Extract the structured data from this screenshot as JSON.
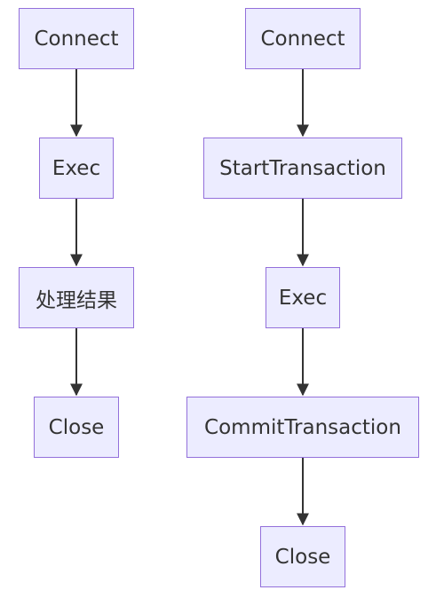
{
  "colors": {
    "node_fill": "#ECECFF",
    "node_border": "#9370DB",
    "edge": "#333333",
    "text": "#333333"
  },
  "flow_left": {
    "nodes": [
      "Connect",
      "Exec",
      "处理结果",
      "Close"
    ]
  },
  "flow_right": {
    "nodes": [
      "Connect",
      "StartTransaction",
      "Exec",
      "CommitTransaction",
      "Close"
    ]
  }
}
